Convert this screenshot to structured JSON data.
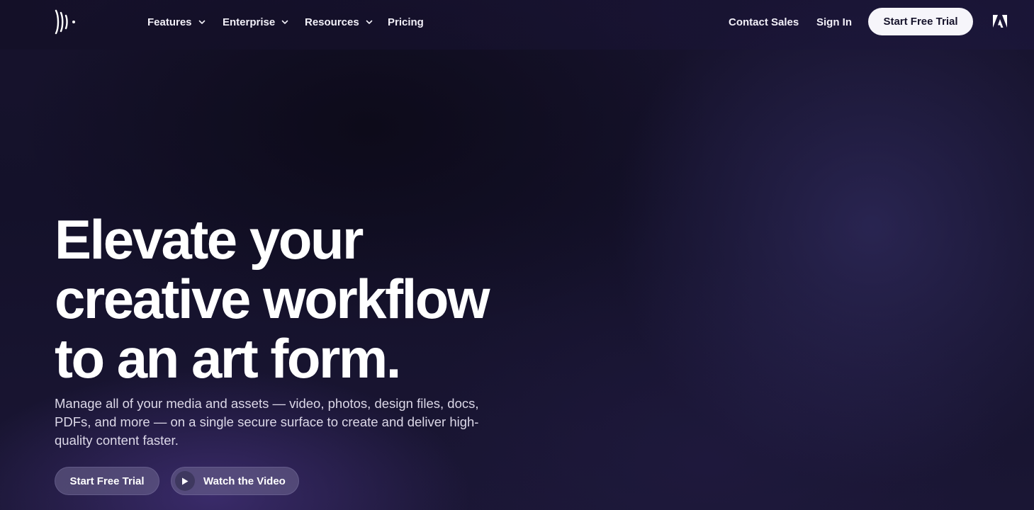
{
  "brand": {
    "logo_icon": "frameio-wave-logo-icon",
    "partner_icon": "adobe-logo-icon"
  },
  "nav": {
    "items": [
      {
        "label": "Features",
        "icon": "chevron-down-icon"
      },
      {
        "label": "Enterprise",
        "icon": "chevron-down-icon"
      },
      {
        "label": "Resources",
        "icon": "chevron-down-icon"
      },
      {
        "label": "Pricing"
      }
    ],
    "contact_sales": "Contact Sales",
    "sign_in": "Sign In",
    "start_trial": "Start Free Trial"
  },
  "hero": {
    "title_lines": [
      "Elevate your",
      "creative workflow",
      "to an art form."
    ],
    "subtitle": "Manage all of your media and assets — video, photos, design files, docs, PDFs, and more — on a single secure surface to create and deliver high-quality content faster.",
    "cta_primary": "Start Free Trial",
    "cta_video": "Watch the Video",
    "video_icon": "play-icon"
  },
  "colors": {
    "background": "#14112a",
    "text": "#ffffff",
    "button_light": "#f6f5fa",
    "button_dark": "#4e4870"
  }
}
